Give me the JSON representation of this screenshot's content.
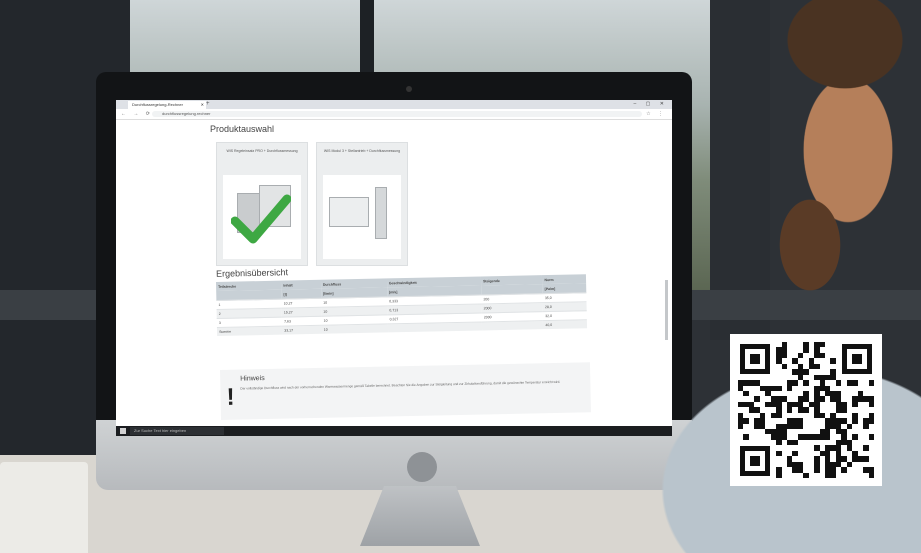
{
  "browser": {
    "tab_title": "Durchflussregelung-Rechner",
    "url": "durchflussregelung.rechner"
  },
  "page": {
    "section_title": "Produktauswahl",
    "products": [
      {
        "title": "WIS Regeleinsatz PRO + Durchflussmessung",
        "selected": true
      },
      {
        "title": "WIS Modul 3 + Stellantrieb + Durchflussmessung",
        "selected": false
      }
    ],
    "results_title": "Ergebnisübersicht",
    "table": {
      "headers": [
        "Teilstrecke",
        "Inhalt",
        "Durchfluss",
        "Geschwindigkeit",
        "Steigende",
        "Norm"
      ],
      "subheaders": [
        "",
        "[l]",
        "[l/min]",
        "[m/s]",
        "",
        "[Pa/m]"
      ],
      "rows": [
        [
          "1",
          "10,27",
          "10",
          "0,333",
          "200",
          "35,0"
        ],
        [
          "2",
          "15,27",
          "10",
          "0,713",
          "2000",
          "28,0"
        ],
        [
          "3",
          "7,63",
          "10",
          "0,327",
          "2000",
          "32,0"
        ],
        [
          "Summe",
          "33,17",
          "10",
          "",
          "",
          "40,0"
        ]
      ]
    },
    "hint": {
      "title": "Hinweis",
      "text": "Der vollständige Durchfluss wird nach der vorherrschenden Warmwassermenge gemäß Tabelle berechnet. Beachten Sie die Angaben zur Steigleitung und zur Zirkulationsführung, damit die gewünschte Temperatur erreicht wird."
    },
    "taskbar_search": "Zur Suche Text hier eingeben"
  },
  "colors": {
    "table_header": "#c8d0d6",
    "check_green": "#3ea843"
  }
}
